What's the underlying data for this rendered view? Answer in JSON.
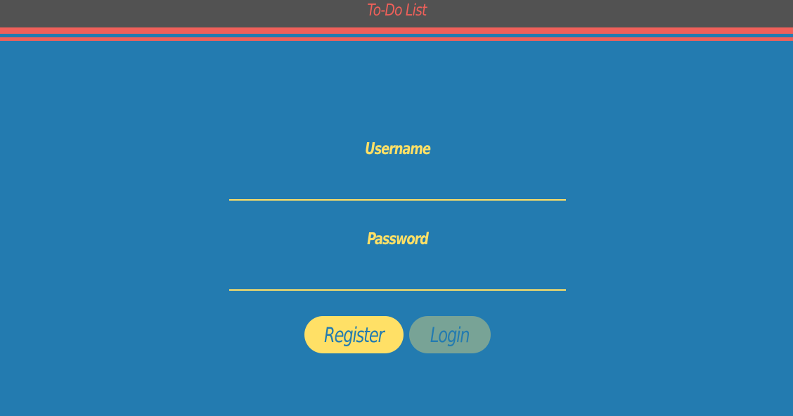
{
  "header": {
    "title": "To-Do List"
  },
  "form": {
    "username_label": "Username",
    "username_value": "",
    "password_label": "Password",
    "password_value": ""
  },
  "buttons": {
    "register_label": "Register",
    "login_label": "Login"
  },
  "colors": {
    "background": "#237bb0",
    "header": "#525252",
    "accent_red": "#f0605a",
    "accent_yellow": "#ffe066",
    "login_button": "#78a396"
  }
}
